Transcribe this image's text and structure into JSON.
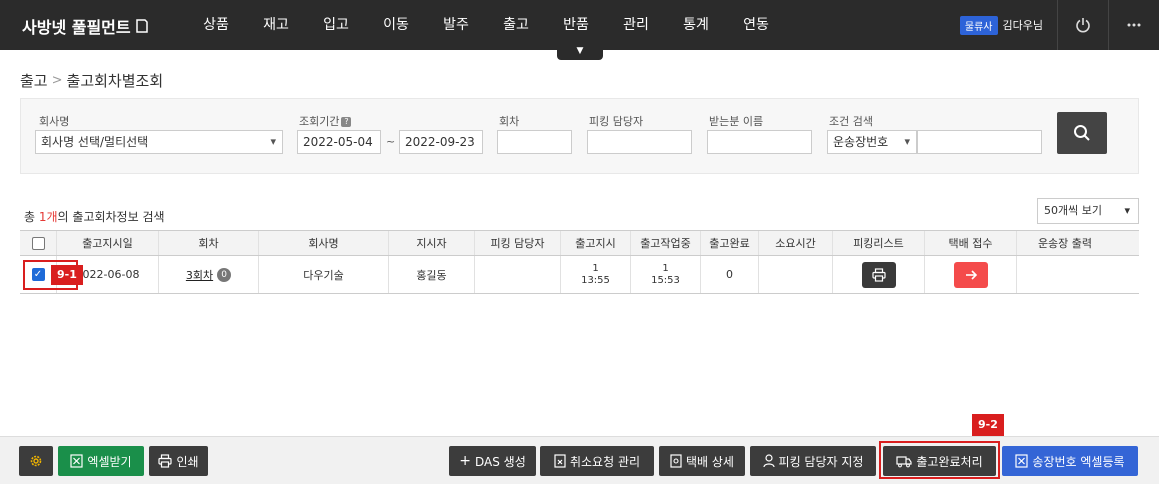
{
  "app": {
    "logo_text": "사방넷 풀필먼트"
  },
  "nav": {
    "items": [
      "상품",
      "재고",
      "입고",
      "이동",
      "발주",
      "출고",
      "반품",
      "관리",
      "통계",
      "연동"
    ],
    "toggle_label": "▼",
    "role_badge": "물류사",
    "user_name": "김다우님",
    "power_icon": "power-icon",
    "more_icon": "more-icon"
  },
  "breadcrumb": {
    "parent": "출고",
    "separator": ">",
    "current": "출고회차별조회"
  },
  "filters": {
    "company_label": "회사명",
    "company_value": "회사명 선택/멀티선택",
    "period_label": "조회기간",
    "period_help": "?",
    "date_from": "2022-05-04",
    "date_sep": "~",
    "date_to": "2022-09-23",
    "round_label": "회차",
    "round_value": "",
    "picker_label": "피킹 담당자",
    "picker_value": "",
    "recipient_label": "받는분 이름",
    "recipient_value": "",
    "condition_label": "조건 검색",
    "condition_select": "운송장번호",
    "condition_value": "",
    "search_icon": "search-icon"
  },
  "summary": {
    "prefix": "총 ",
    "count": "1개",
    "suffix": "의 출고회차정보 검색"
  },
  "page_size": "50개씩 보기",
  "table": {
    "headers": [
      "",
      "출고지시일",
      "회차",
      "회사명",
      "지시자",
      "피킹 담당자",
      "출고지시",
      "출고작업중",
      "출고완료",
      "소요시간",
      "피킹리스트",
      "택배 접수",
      "운송장 출력"
    ],
    "rows": [
      {
        "checked": true,
        "date": "2022-06-08",
        "round": "3회차",
        "round_info": "0",
        "company": "다우기술",
        "instructor": "홍길동",
        "picker": "",
        "ordered_count": "1",
        "ordered_time": "13:55",
        "working_count": "1",
        "working_time": "15:53",
        "done": "0",
        "elapsed": ""
      }
    ]
  },
  "callouts": {
    "first": "9-1",
    "second": "9-2"
  },
  "toolbar": {
    "settings_icon": "gear-icon",
    "excel_download": "엑셀받기",
    "print": "인쇄",
    "das_create": "DAS 생성",
    "cancel_request": "취소요청 관리",
    "courier_detail": "택배 상세",
    "assign_picker": "피킹 담당자 지정",
    "complete_shipping": "출고완료처리",
    "invoice_excel": "송장번호 엑셀등록"
  }
}
